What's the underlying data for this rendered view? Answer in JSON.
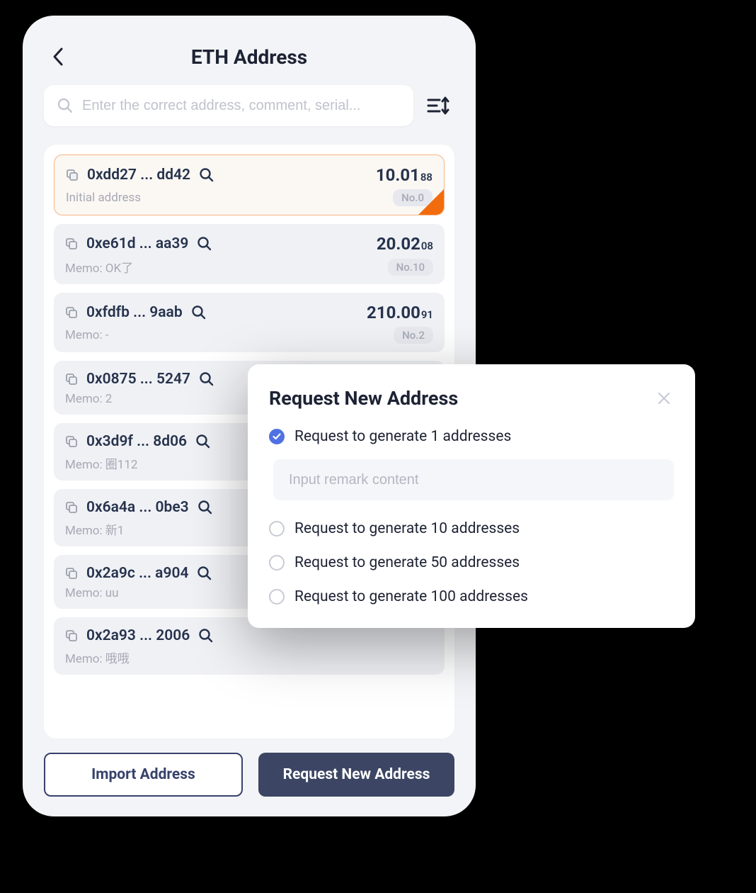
{
  "header": {
    "title": "ETH Address"
  },
  "search": {
    "placeholder": "Enter the correct address, comment, serial..."
  },
  "addresses": [
    {
      "addr": "0xdd27 ... dd42",
      "amount_int": "10.01",
      "amount_dec": "88",
      "memo": "Initial address",
      "no": "No.0",
      "selected": true,
      "flag": true
    },
    {
      "addr": "0xe61d ... aa39",
      "amount_int": "20.02",
      "amount_dec": "08",
      "memo": "Memo: OK了",
      "no": "No.10"
    },
    {
      "addr": "0xfdfb ... 9aab",
      "amount_int": "210.00",
      "amount_dec": "91",
      "memo": "Memo: -",
      "no": "No.2"
    },
    {
      "addr": "0x0875 ... 5247",
      "memo": "Memo: 2"
    },
    {
      "addr": "0x3d9f ... 8d06",
      "memo": "Memo: 圈112"
    },
    {
      "addr": "0x6a4a ... 0be3",
      "memo": "Memo: 新1"
    },
    {
      "addr": "0x2a9c ... a904",
      "memo": "Memo: uu"
    },
    {
      "addr": "0x2a93 ... 2006",
      "memo": "Memo: 哦哦"
    }
  ],
  "footer": {
    "import_label": "Import Address",
    "request_label": "Request New Address"
  },
  "modal": {
    "title": "Request New Address",
    "remark_placeholder": "Input remark content",
    "options": [
      {
        "label": "Request to generate 1 addresses",
        "checked": true,
        "has_remark": true
      },
      {
        "label": "Request to generate 10 addresses",
        "checked": false
      },
      {
        "label": "Request to generate 50 addresses",
        "checked": false
      },
      {
        "label": "Request to generate 100 addresses",
        "checked": false
      }
    ]
  }
}
